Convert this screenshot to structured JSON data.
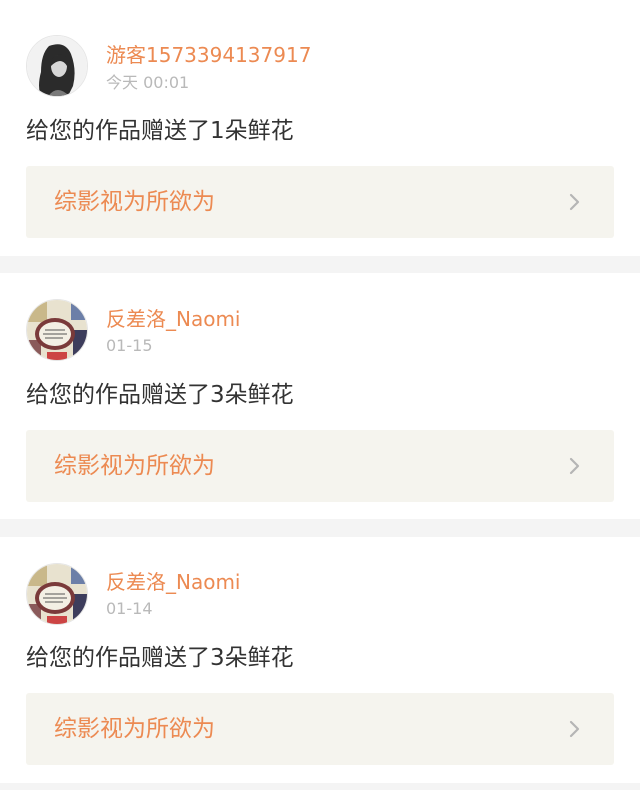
{
  "colors": {
    "accent": "#ec8a52",
    "link_bg": "#f5f4ee",
    "divider": "#f4f4f4",
    "top_indicator": "#e8528c"
  },
  "notifications": [
    {
      "avatar_icon": "girl-portrait-avatar",
      "username": "游客1573394137917",
      "time": "今天 00:01",
      "message": "给您的作品赠送了1朵鲜花",
      "work_title": "综影视为所欲为",
      "chevron_icon": "chevron-right-icon"
    },
    {
      "avatar_icon": "cartoon-collage-avatar",
      "username": "反差洛_Naomi",
      "time": "01-15",
      "message": "给您的作品赠送了3朵鲜花",
      "work_title": "综影视为所欲为",
      "chevron_icon": "chevron-right-icon"
    },
    {
      "avatar_icon": "cartoon-collage-avatar",
      "username": "反差洛_Naomi",
      "time": "01-14",
      "message": "给您的作品赠送了3朵鲜花",
      "work_title": "综影视为所欲为",
      "chevron_icon": "chevron-right-icon"
    }
  ]
}
